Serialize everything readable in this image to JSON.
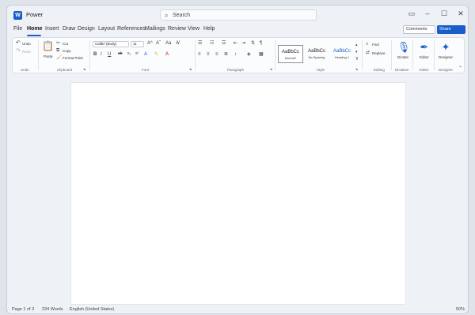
{
  "window": {
    "app_logo": "W",
    "title": "Power"
  },
  "search": {
    "label": "Search"
  },
  "menu": [
    "File",
    "Home",
    "Insert",
    "Draw",
    "Design",
    "Layout",
    "References",
    "Mailings",
    "Review",
    "View",
    "Help"
  ],
  "actions": {
    "comments": "Comments",
    "share": "Share"
  },
  "ribbon": {
    "undo": {
      "undo": "Undo",
      "redo": "Redo",
      "group": "Undo"
    },
    "clipboard": {
      "paste": "Paste",
      "cut": "Cut",
      "copy": "Copy",
      "format_painter": "Format Paint",
      "group": "Clipboard"
    },
    "font": {
      "family": "Calibri (Body)",
      "size": "11",
      "group": "Font"
    },
    "paragraph": {
      "group": "Paragraph"
    },
    "styles": {
      "items": [
        {
          "sample": "AaBbCc",
          "name": "Normal*"
        },
        {
          "sample": "AaBbCc",
          "name": "No Spacing"
        },
        {
          "sample": "AaBbCc",
          "name": "Heading 1"
        }
      ],
      "group": "Style"
    },
    "editing": {
      "find": "Find",
      "replace": "Replace",
      "group": "Editing"
    },
    "dictation": {
      "dictate": "Dictate",
      "group": "Dictation"
    },
    "editor": {
      "editor": "Editor",
      "group": "Editor"
    },
    "designer": {
      "designer": "Designer",
      "group": "Designer"
    }
  },
  "status": {
    "page": "Page 1 of 3",
    "words": "234 Words",
    "language": "English (United States)",
    "zoom": "50%"
  }
}
